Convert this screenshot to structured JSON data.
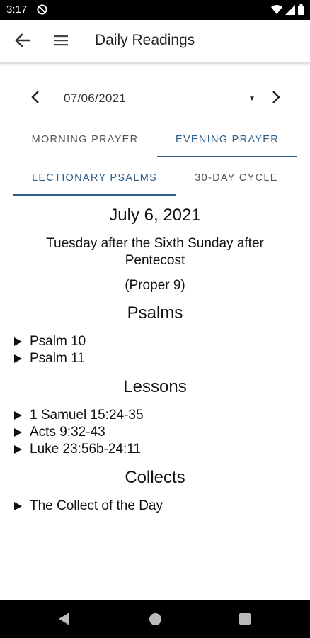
{
  "status_bar": {
    "time": "3:17",
    "icons": [
      "dnd-icon",
      "wifi-icon",
      "signal-icon",
      "battery-icon"
    ]
  },
  "app_bar": {
    "title": "Daily Readings",
    "back_icon": "arrow-left-icon",
    "menu_icon": "hamburger-menu-icon"
  },
  "date_picker": {
    "value": "07/06/2021",
    "prev_icon": "chevron-left-icon",
    "next_icon": "chevron-right-icon",
    "dropdown_icon": "caret-down-icon"
  },
  "office_tabs": {
    "tabs": [
      {
        "label": "Morning Prayer",
        "active": false
      },
      {
        "label": "Evening Prayer",
        "active": true
      }
    ]
  },
  "source_tabs": {
    "tabs": [
      {
        "label": "Lectionary Psalms",
        "active": true
      },
      {
        "label": "30-Day Cycle",
        "active": false
      }
    ]
  },
  "content": {
    "date_title": "July 6, 2021",
    "day_name": "Tuesday after the Sixth Sunday after Pentecost",
    "proper": "(Proper 9)",
    "sections": [
      {
        "heading": "Psalms",
        "items": [
          "Psalm 10",
          "Psalm 11"
        ]
      },
      {
        "heading": "Lessons",
        "items": [
          "1 Samuel 15:24-35",
          "Acts 9:32-43",
          "Luke 23:56b-24:11"
        ]
      },
      {
        "heading": "Collects",
        "items": [
          "The Collect of the Day"
        ]
      }
    ]
  },
  "colors": {
    "accent": "#2e5f8a",
    "text": "#111111",
    "system_bar": "#000000"
  }
}
